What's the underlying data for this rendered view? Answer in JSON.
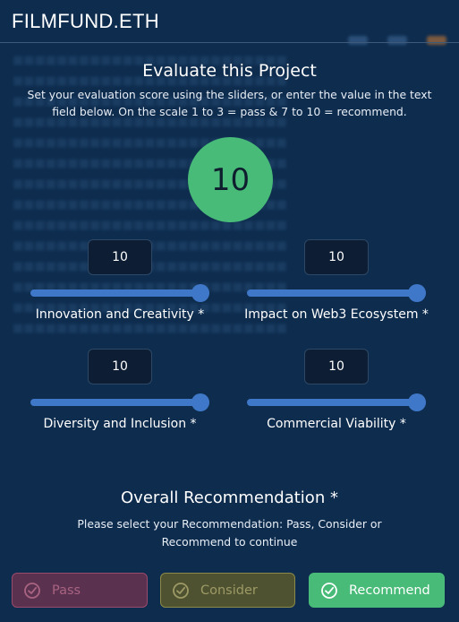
{
  "header": {
    "brand": "FILMFUND.ETH"
  },
  "modal": {
    "title": "Evaluate this Project",
    "subtitle": "Set your evaluation score using the sliders, or enter the value in the text field below. On the scale 1 to 3 = pass & 7 to 10 = recommend.",
    "overall_score": "10",
    "metrics": [
      {
        "label": "Innovation and Creativity *",
        "value": "10",
        "level_fraction": 1.0
      },
      {
        "label": "Impact on Web3 Ecosystem *",
        "value": "10",
        "level_fraction": 1.0
      },
      {
        "label": "Diversity and Inclusion *",
        "value": "10",
        "level_fraction": 1.0
      },
      {
        "label": "Commercial Viability *",
        "value": "10",
        "level_fraction": 1.0
      }
    ],
    "recommendation": {
      "title": "Overall Recommendation *",
      "subtitle": "Please select your Recommendation: Pass, Consider or Recommend to continue",
      "buttons": [
        {
          "label": "Pass",
          "icon": "check-circle-icon"
        },
        {
          "label": "Consider",
          "icon": "check-circle-icon"
        },
        {
          "label": "Recommend",
          "icon": "check-circle-icon"
        }
      ]
    }
  },
  "colors": {
    "background": "#0e2c4e",
    "score_green": "#48bb78",
    "slider_blue": "#3f78c8",
    "pass_bg": "#5b3150",
    "consider_bg": "#4e5230",
    "recommend_bg": "#48bb78"
  }
}
